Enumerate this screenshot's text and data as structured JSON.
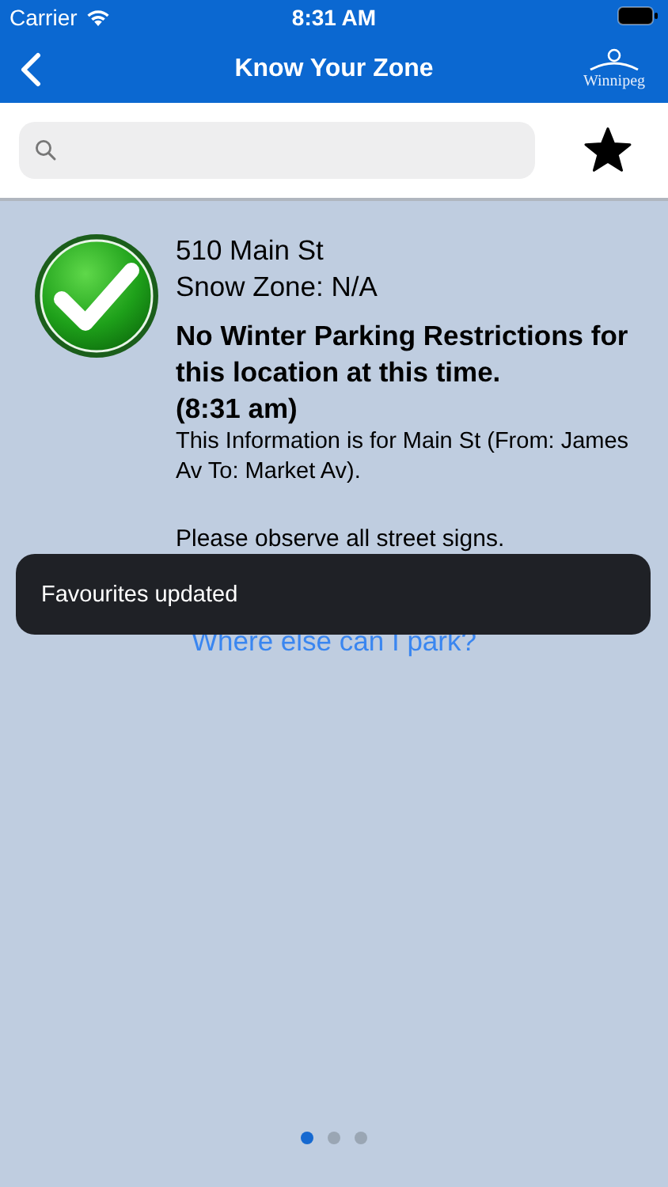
{
  "status_bar": {
    "carrier": "Carrier",
    "time": "8:31 AM"
  },
  "nav_bar": {
    "title": "Know Your Zone",
    "logo_text": "Winnipeg"
  },
  "search": {
    "favourite": true
  },
  "result": {
    "address": "510 Main St",
    "snow_zone": "Snow Zone: N/A",
    "headline": "No Winter Parking Restrictions for this location at this time.",
    "time": "(8:31 am)",
    "info": "This Information is for Main St (From: James Av To: Market Av).",
    "notice": "Please observe all street signs.",
    "link": "Where else can I park?"
  },
  "toast": "Favourites updated",
  "pages": [
    {
      "selected": true
    },
    {
      "selected": false
    },
    {
      "selected": false
    }
  ]
}
